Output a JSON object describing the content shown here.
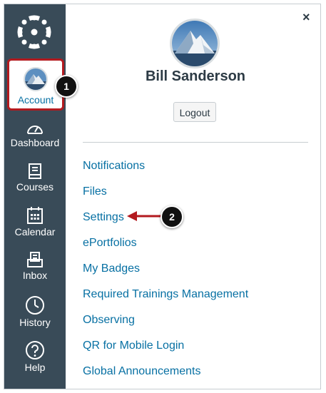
{
  "nav": {
    "account_label": "Account",
    "items": [
      {
        "label": "Dashboard",
        "icon": "dashboard-icon"
      },
      {
        "label": "Courses",
        "icon": "courses-icon"
      },
      {
        "label": "Calendar",
        "icon": "calendar-icon"
      },
      {
        "label": "Inbox",
        "icon": "inbox-icon"
      },
      {
        "label": "History",
        "icon": "history-icon"
      },
      {
        "label": "Help",
        "icon": "help-icon"
      }
    ]
  },
  "callouts": {
    "one": "1",
    "two": "2"
  },
  "tray": {
    "close_label": "×",
    "user_name": "Bill Sanderson",
    "logout_label": "Logout",
    "links": [
      "Notifications",
      "Files",
      "Settings",
      "ePortfolios",
      "My Badges",
      "Required Trainings Management",
      "Observing",
      "QR for Mobile Login",
      "Global Announcements"
    ]
  },
  "colors": {
    "nav_bg": "#394b58",
    "link": "#0770a3",
    "highlight": "#b31a1f"
  }
}
